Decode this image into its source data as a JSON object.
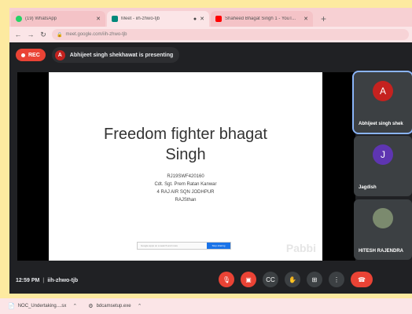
{
  "tabs": [
    {
      "label": "(19) WhatsApp",
      "icon": "whatsapp-icon",
      "color": "#25d366",
      "extra": ""
    },
    {
      "label": "Meet - iih-zhwo-tjb",
      "icon": "meet-icon",
      "color": "#00897b",
      "extra": "●"
    },
    {
      "label": "Shaheed Bhagat Singh 1 - YouT...",
      "icon": "youtube-icon",
      "color": "#ff0000",
      "extra": ""
    }
  ],
  "address": {
    "url": "meet.google.com/iih-zhwo-tjb"
  },
  "meet": {
    "rec_label": "REC",
    "presenter_initial": "A",
    "presenting_text": "Abhijeet singh shekhawat is presenting",
    "slide": {
      "title": "Freedom fighter bhagat Singh",
      "lines": [
        "RJ19SWF420160",
        "Cdt. Sgt. Prem Ratan Kanwar",
        "4 RAJ AIR SQN JODHPUR",
        "RAJSthan"
      ],
      "input_text": "Google apps on a search and more",
      "button_text": "Stop sharing",
      "watermark": "Pabbi"
    },
    "participants": [
      {
        "initial": "A",
        "name": "Abhijeet singh shek",
        "color": "#c5221f",
        "active": true
      },
      {
        "initial": "J",
        "name": "Jagdish",
        "color": "#5e35b1",
        "active": false
      },
      {
        "initial": "",
        "name": "HITESH RAJENDRA",
        "color": "#7b8a6e",
        "active": false
      }
    ],
    "time": "12:59 PM",
    "meeting_code": "iih-zhwo-tjb"
  },
  "downloads": [
    {
      "name": "NOC_Undertaking....sx"
    },
    {
      "name": "bdcamsetup.exe"
    }
  ]
}
